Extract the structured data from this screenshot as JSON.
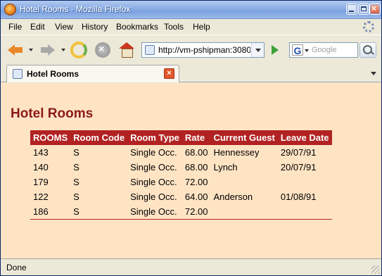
{
  "window": {
    "title": "Hotel Rooms - Mozilla Firefox"
  },
  "menu": {
    "items": [
      "File",
      "Edit",
      "View",
      "History",
      "Bookmarks",
      "Tools",
      "Help"
    ]
  },
  "navigation": {
    "url": "http://vm-pshipman:3080/d",
    "search_placeholder": "Google",
    "search_engine_letter": "G"
  },
  "tabs": [
    {
      "title": "Hotel Rooms"
    }
  ],
  "page": {
    "heading": "Hotel Rooms",
    "columns": [
      "ROOMS",
      "Room Code",
      "Room Type",
      "Rate",
      "Current Guest",
      "Leave Date"
    ],
    "rows": [
      [
        "143",
        "S",
        "Single Occ.",
        "68.00",
        "Hennessey",
        "29/07/91"
      ],
      [
        "140",
        "S",
        "Single Occ.",
        "68.00",
        "Lynch",
        "20/07/91"
      ],
      [
        "179",
        "S",
        "Single Occ.",
        "72.00",
        "",
        ""
      ],
      [
        "122",
        "S",
        "Single Occ.",
        "64.00",
        "Anderson",
        "01/08/91"
      ],
      [
        "186",
        "S",
        "Single Occ.",
        "72.00",
        "",
        ""
      ]
    ]
  },
  "status": {
    "text": "Done"
  },
  "colors": {
    "content_background": "#ffe4c4",
    "heading": "#8b1a1a",
    "table_header": "#b22222"
  }
}
